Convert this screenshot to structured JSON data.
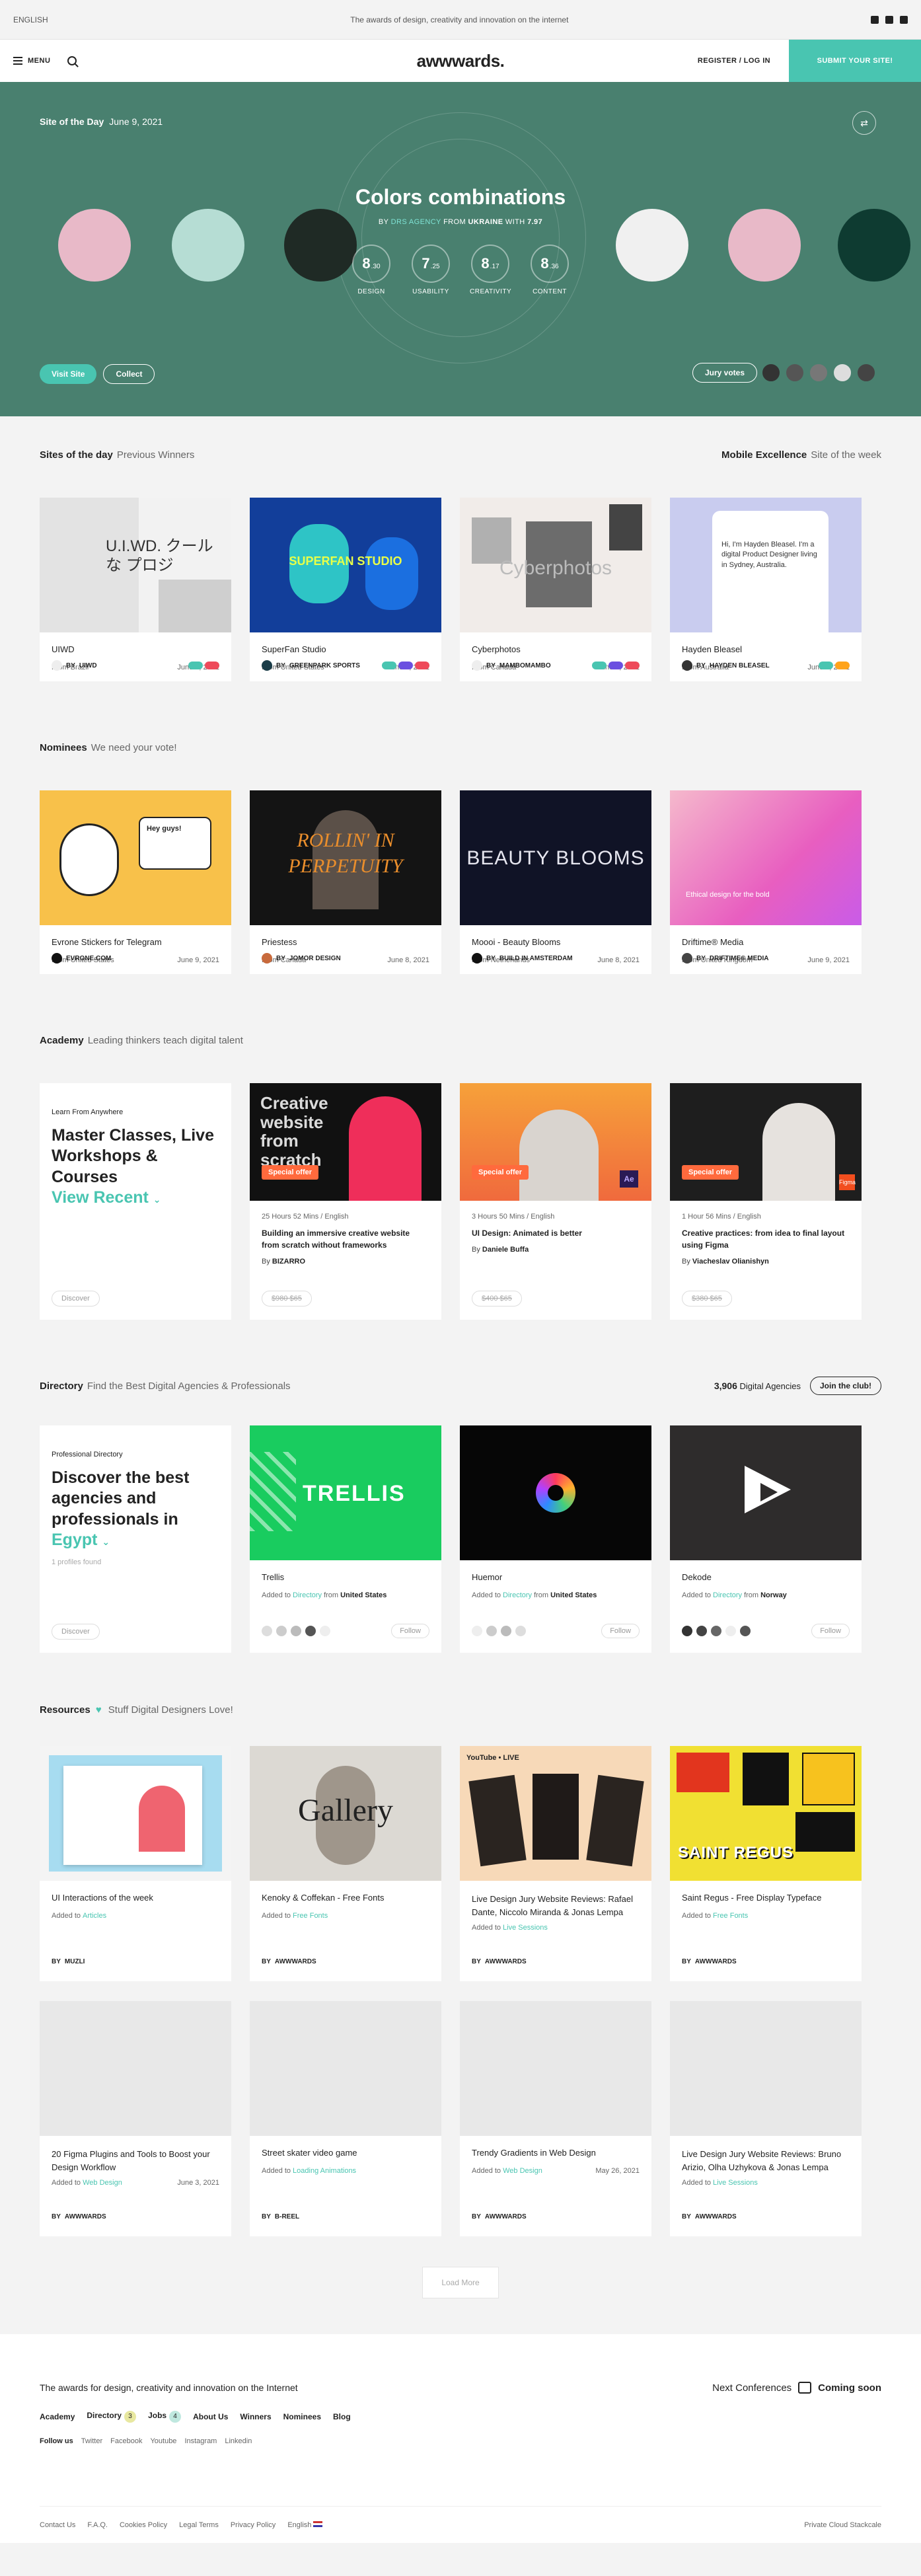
{
  "topbar": {
    "language": "ENGLISH",
    "tagline": "The awards of design, creativity and innovation on the internet",
    "social": [
      "instagram-icon",
      "twitter-icon",
      "facebook-icon"
    ]
  },
  "navbar": {
    "menu": "MENU",
    "logo": "awwwards.",
    "login": "REGISTER / LOG IN",
    "submit": "SUBMIT YOUR SITE!"
  },
  "hero": {
    "label": "Site of the Day",
    "date": "June 9, 2021",
    "title": "Colors combinations",
    "by": "BY",
    "agency": "DRS AGENCY",
    "from": "FROM",
    "country": "UKRAINE",
    "with": "WITH",
    "total": "7.97",
    "scores": [
      {
        "value": "8",
        "dec": ".30",
        "label": "DESIGN"
      },
      {
        "value": "7",
        "dec": ".25",
        "label": "USABILITY"
      },
      {
        "value": "8",
        "dec": ".17",
        "label": "CREATIVITY"
      },
      {
        "value": "8",
        "dec": ".36",
        "label": "CONTENT"
      }
    ],
    "visit": "Visit Site",
    "collect": "Collect",
    "jury": "Jury votes",
    "colors": [
      "#e8b9c8",
      "#b6ddd4",
      "#1f2a25",
      "#f0f0f0",
      "#e8b9c8",
      "#0e3b31"
    ]
  },
  "sites_of_day": {
    "title": "Sites of the day",
    "sub": "Previous Winners",
    "mobile_title": "Mobile Excellence",
    "mobile_sub": "Site of the week",
    "cards": [
      {
        "name": "UIWD",
        "from": "From Brazil",
        "date": "June 8, 2021",
        "by": "BY",
        "author": "UIWD",
        "thumb_text": "U.I.WD. クールな プロジ"
      },
      {
        "name": "SuperFan Studio",
        "from": "From United States",
        "date": "June 7, 2021",
        "by": "BY",
        "author": "GREENPARK SPORTS",
        "thumb_text": "SUPERFAN STUDIO"
      },
      {
        "name": "Cyberphotos",
        "from": "From Canada",
        "date": "June 6, 2021",
        "by": "BY",
        "author": "MAMBOMAMBO",
        "thumb_text": "Cyberphotos"
      },
      {
        "name": "Hayden Bleasel",
        "from": "From Australia",
        "date": "June 9, 2021",
        "by": "BY",
        "author": "HAYDEN BLEASEL",
        "thumb_text": "Hi, I'm Hayden Bleasel. I'm a digital Product Designer living in Sydney, Australia."
      }
    ]
  },
  "nominees": {
    "title": "Nominees",
    "sub": "We need your vote!",
    "cards": [
      {
        "name": "Evrone Stickers for Telegram",
        "from": "From United States",
        "date": "June 9, 2021",
        "author": "EVRONE.COM",
        "thumb_text": "Hey guys!"
      },
      {
        "name": "Priestess",
        "from": "From Canada",
        "date": "June 8, 2021",
        "by": "BY",
        "author": "JOMOR DESIGN",
        "thumb_text": "ROLLIN' IN PERPETUITY"
      },
      {
        "name": "Moooi - Beauty Blooms",
        "from": "From Netherlands",
        "date": "June 8, 2021",
        "by": "BY",
        "author": "BUILD IN AMSTERDAM",
        "thumb_text": "BEAUTY BLOOMS"
      },
      {
        "name": "Driftime® Media",
        "from": "From United Kingdom",
        "date": "June 9, 2021",
        "by": "BY",
        "author": "DRIFTIME® MEDIA",
        "thumb_text": "Ethical design for the bold"
      }
    ]
  },
  "academy": {
    "title": "Academy",
    "sub": "Leading thinkers teach digital talent",
    "promo": {
      "kicker": "Learn From Anywhere",
      "heading": "Master Classes, Live Workshops & Courses",
      "accent": "View Recent",
      "discover": "Discover"
    },
    "cards": [
      {
        "duration": "25 Hours 52 Mins / English",
        "desc": "Building an immersive creative website from scratch without frameworks",
        "by": "By",
        "author": "BIZARRO",
        "price": "$980 $65",
        "offer": "Special offer",
        "thumb_text": "Creative website from scratch"
      },
      {
        "duration": "3 Hours 50 Mins / English",
        "desc": "UI Design: Animated is better",
        "by": "By",
        "author": "Daniele Buffa",
        "price": "$400 $65",
        "offer": "Special offer",
        "thumb_text": "Ae"
      },
      {
        "duration": "1 Hour 56 Mins / English",
        "desc": "Creative practices: from idea to final layout using Figma",
        "by": "By",
        "author": "Viacheslav Olianishyn",
        "price": "$380 $65",
        "offer": "Special offer",
        "thumb_text": "Figma"
      }
    ]
  },
  "directory": {
    "title": "Directory",
    "sub": "Find the Best Digital Agencies & Professionals",
    "count": "3,906",
    "count_label": "Digital Agencies",
    "join": "Join the club!",
    "promo": {
      "kicker": "Professional Directory",
      "heading": "Discover the best agencies and professionals in",
      "accent": "Egypt",
      "found": "1 profiles found",
      "discover": "Discover"
    },
    "cards": [
      {
        "name": "Trellis",
        "added": "Added to",
        "dir": "Directory",
        "from": "from",
        "country": "United States",
        "follow": "Follow",
        "thumb_text": "TRELLIS"
      },
      {
        "name": "Huemor",
        "added": "Added to",
        "dir": "Directory",
        "from": "from",
        "country": "United States",
        "follow": "Follow"
      },
      {
        "name": "Dekode",
        "added": "Added to",
        "dir": "Directory",
        "from": "from",
        "country": "Norway",
        "follow": "Follow"
      }
    ]
  },
  "resources": {
    "title": "Resources",
    "sub": "Stuff Digital Designers Love!",
    "cards": [
      {
        "name": "UI Interactions of the week",
        "added": "Added to",
        "cat": "Articles",
        "date": "",
        "by": "BY",
        "author": "MUZLI"
      },
      {
        "name": "Kenoky & Coffekan - Free Fonts",
        "added": "Added to",
        "cat": "Free Fonts",
        "date": "",
        "by": "BY",
        "author": "AWWWARDS",
        "thumb_text": "Gallery"
      },
      {
        "name": "Live Design Jury Website Reviews: Rafael Dante, Niccolo Miranda & Jonas Lempa",
        "added": "Added to",
        "cat": "Live Sessions",
        "date": "",
        "by": "BY",
        "author": "AWWWARDS",
        "thumb_text": "YouTube • LIVE"
      },
      {
        "name": "Saint Regus - Free Display Typeface",
        "added": "Added to",
        "cat": "Free Fonts",
        "date": "",
        "by": "BY",
        "author": "AWWWARDS",
        "thumb_text": "SAINT REGUS"
      },
      {
        "name": "20 Figma Plugins and Tools to Boost your Design Workflow",
        "added": "Added to",
        "cat": "Web Design",
        "date": "June 3, 2021",
        "by": "BY",
        "author": "AWWWARDS"
      },
      {
        "name": "Street skater video game",
        "added": "Added to",
        "cat": "Loading Animations",
        "date": "",
        "by": "BY",
        "author": "B-REEL"
      },
      {
        "name": "Trendy Gradients in Web Design",
        "added": "Added to",
        "cat": "Web Design",
        "date": "May 26, 2021",
        "by": "BY",
        "author": "AWWWARDS"
      },
      {
        "name": "Live Design Jury Website Reviews: Bruno Arizio, Olha Uzhykova & Jonas Lempa",
        "added": "Added to",
        "cat": "Live Sessions",
        "date": "",
        "by": "BY",
        "author": "AWWWARDS"
      }
    ],
    "load_more": "Load More"
  },
  "footer": {
    "tagline": "The awards for design, creativity and innovation on the Internet",
    "next_conf": "Next Conferences",
    "coming_soon": "Coming soon",
    "nav": [
      {
        "label": "Academy",
        "badge": ""
      },
      {
        "label": "Directory",
        "badge": "3"
      },
      {
        "label": "Jobs",
        "badge": "4"
      },
      {
        "label": "About Us",
        "badge": ""
      },
      {
        "label": "Winners",
        "badge": ""
      },
      {
        "label": "Nominees",
        "badge": ""
      },
      {
        "label": "Blog",
        "badge": ""
      }
    ],
    "follow_label": "Follow us",
    "follow": [
      "Twitter",
      "Facebook",
      "Youtube",
      "Instagram",
      "Linkedin"
    ],
    "bottom_links": [
      "Contact Us",
      "F.A.Q.",
      "Cookies Policy",
      "Legal Terms",
      "Privacy Policy",
      "English"
    ],
    "credit": "Private Cloud Stackcale"
  }
}
